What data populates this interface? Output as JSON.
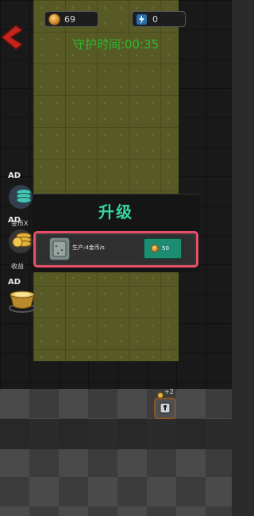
{
  "hud": {
    "coins": "69",
    "energy": "0",
    "timer": "守护时间:00:35"
  },
  "side_items": [
    {
      "ad": "AD",
      "label": "金币X",
      "icon": "coin-stack-icon"
    },
    {
      "ad": "AD",
      "label": "收益",
      "icon": "gold-coins-icon"
    },
    {
      "ad": "AD",
      "label": "",
      "icon": "treasure-pot-icon"
    }
  ],
  "dialog": {
    "title": "升级",
    "production": "生产:4金币/s",
    "cost": "50"
  },
  "generator": {
    "plus": "+2"
  },
  "colors": {
    "timer": "#2fb82f",
    "title": "#38d6a0",
    "highlight": "#e8506a",
    "buy_button": "#1d8d72",
    "back_arrow": "#c2241e"
  }
}
